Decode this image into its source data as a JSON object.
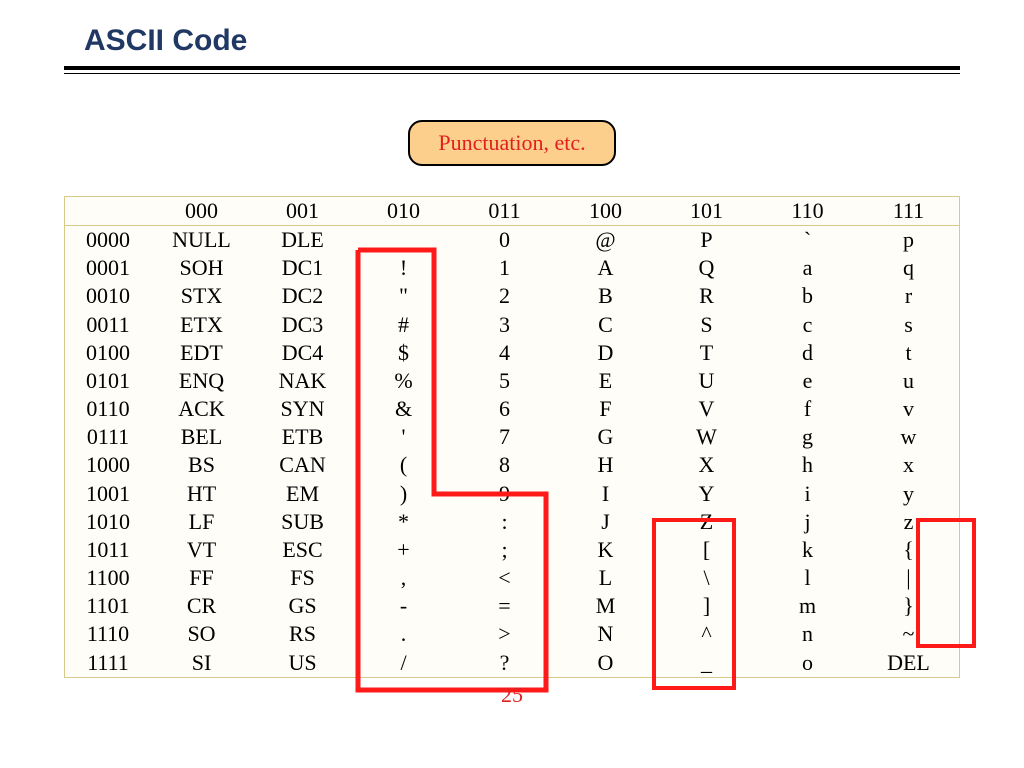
{
  "title": "ASCII Code",
  "badge": "Punctuation, etc.",
  "page_number": "25",
  "col_headers": [
    "000",
    "001",
    "010",
    "011",
    "100",
    "101",
    "110",
    "111"
  ],
  "row_headers": [
    "0000",
    "0001",
    "0010",
    "0011",
    "0100",
    "0101",
    "0110",
    "0111",
    "1000",
    "1001",
    "1010",
    "1011",
    "1100",
    "1101",
    "1110",
    "1111"
  ],
  "cells": [
    [
      "NULL",
      "DLE",
      " ",
      "0",
      "@",
      "P",
      "`",
      "p"
    ],
    [
      "SOH",
      "DC1",
      "!",
      "1",
      "A",
      "Q",
      "a",
      "q"
    ],
    [
      "STX",
      "DC2",
      "\"",
      "2",
      "B",
      "R",
      "b",
      "r"
    ],
    [
      "ETX",
      "DC3",
      "#",
      "3",
      "C",
      "S",
      "c",
      "s"
    ],
    [
      "EDT",
      "DC4",
      "$",
      "4",
      "D",
      "T",
      "d",
      "t"
    ],
    [
      "ENQ",
      "NAK",
      "%",
      "5",
      "E",
      "U",
      "e",
      "u"
    ],
    [
      "ACK",
      "SYN",
      "&",
      "6",
      "F",
      "V",
      "f",
      "v"
    ],
    [
      "BEL",
      "ETB",
      "'",
      "7",
      "G",
      "W",
      "g",
      "w"
    ],
    [
      "BS",
      "CAN",
      "(",
      "8",
      "H",
      "X",
      "h",
      "x"
    ],
    [
      "HT",
      "EM",
      ")",
      "9",
      "I",
      "Y",
      "i",
      "y"
    ],
    [
      "LF",
      "SUB",
      "*",
      ":",
      "J",
      "Z",
      "j",
      "z"
    ],
    [
      "VT",
      "ESC",
      "+",
      ";",
      "K",
      "[",
      "k",
      "{"
    ],
    [
      "FF",
      "FS",
      ",",
      "<",
      "L",
      "\\",
      "l",
      "|"
    ],
    [
      "CR",
      "GS",
      "-",
      "=",
      "M",
      "]",
      "m",
      "}"
    ],
    [
      "SO",
      "RS",
      ".",
      ">",
      "N",
      "^",
      "n",
      "~"
    ],
    [
      "SI",
      "US",
      "/",
      "?",
      "O",
      "_",
      "o",
      "DEL"
    ]
  ],
  "highlights": {
    "col010_notch": true,
    "col101_bottom": true,
    "col111_small": true
  }
}
